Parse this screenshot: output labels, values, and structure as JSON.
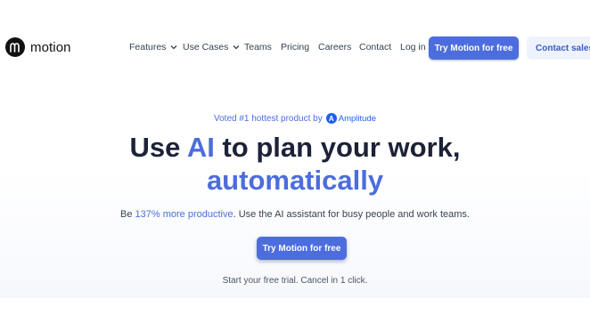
{
  "brand": {
    "name": "motion",
    "logo_glyph": "m"
  },
  "nav": {
    "items": [
      {
        "label": "Features",
        "has_dropdown": true
      },
      {
        "label": "Use Cases",
        "has_dropdown": true
      },
      {
        "label": "Teams"
      },
      {
        "label": "Pricing"
      },
      {
        "label": "Careers"
      },
      {
        "label": "Contact"
      },
      {
        "label": "Log in"
      }
    ],
    "primary_cta": "Try Motion for free",
    "secondary_cta": "Contact sales"
  },
  "hero": {
    "voted_text": "Voted #1 hottest product by",
    "partner_glyph": "A",
    "partner_name": "Amplitude",
    "headline_pre": "Use ",
    "headline_accent": "AI",
    "headline_post": " to plan your work,",
    "headline_line2": "automatically",
    "subtitle_pre": "Be ",
    "subtitle_accent": "137% more productive",
    "subtitle_post": ". Use the AI assistant for busy people and work teams.",
    "cta_label": "Try Motion for free",
    "trial_note": "Start your free trial. Cancel in 1 click."
  },
  "colors": {
    "accent": "#4c6ddd",
    "heading": "#1c2237",
    "amplitude": "#1e61f0",
    "secondary_bg": "#eef2fc"
  }
}
